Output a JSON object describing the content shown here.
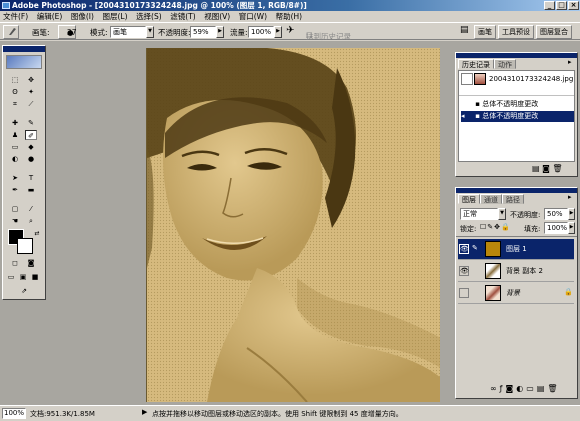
{
  "window": {
    "title": "Adobe Photoshop - [2004310173324248.jpg @ 100% (图层 1, RGB/8#)]",
    "minimize": "_",
    "maximize": "□",
    "close": "×"
  },
  "menu": [
    "文件(F)",
    "编辑(E)",
    "图像(I)",
    "图层(L)",
    "选择(S)",
    "滤镜(T)",
    "视图(V)",
    "窗口(W)",
    "帮助(H)"
  ],
  "options": {
    "brush_label": "画笔:",
    "brush_size": "27",
    "mode_label": "模式:",
    "mode_value": "画笔",
    "opacity_label": "不透明度:",
    "opacity_value": "59%",
    "flow_label": "流量:",
    "flow_value": "100%",
    "erase_history_label": "抹到历史记录",
    "palette_tabs": [
      "画笔",
      "工具预设",
      "图层复合"
    ]
  },
  "toolbox": {
    "fg_color": "#000000",
    "bg_color": "#ffffff"
  },
  "history_panel": {
    "tabs": [
      "历史记录",
      "动作"
    ],
    "snapshot_name": "2004310173324248.jpg",
    "steps": [
      "总体不透明度更改",
      "总体不透明度更改"
    ]
  },
  "layers_panel": {
    "tabs": [
      "图层",
      "通道",
      "路径"
    ],
    "blend_mode": "正常",
    "opacity_label": "不透明度:",
    "opacity_value": "50%",
    "lock_label": "锁定:",
    "fill_label": "填充:",
    "fill_value": "100%",
    "layers": [
      {
        "name": "图层 1",
        "selected": true,
        "thumb_color": "#b8860b"
      },
      {
        "name": "背景 副本 2",
        "selected": false,
        "thumb_color": "#e8e0d0"
      },
      {
        "name": "背景",
        "selected": false,
        "thumb_color": "#c89070"
      }
    ]
  },
  "status": {
    "zoom": "100%",
    "doc_size": "文档:951.3K/1.85M",
    "hint": "点按并拖移以移动图层或移动选区的副本。使用 Shift 键限制到 45 度增量方向。"
  },
  "colors": {
    "title_blue": "#0a246a",
    "canvas_sepia": "#d4b67a",
    "layer_fill": "#b8860b"
  }
}
